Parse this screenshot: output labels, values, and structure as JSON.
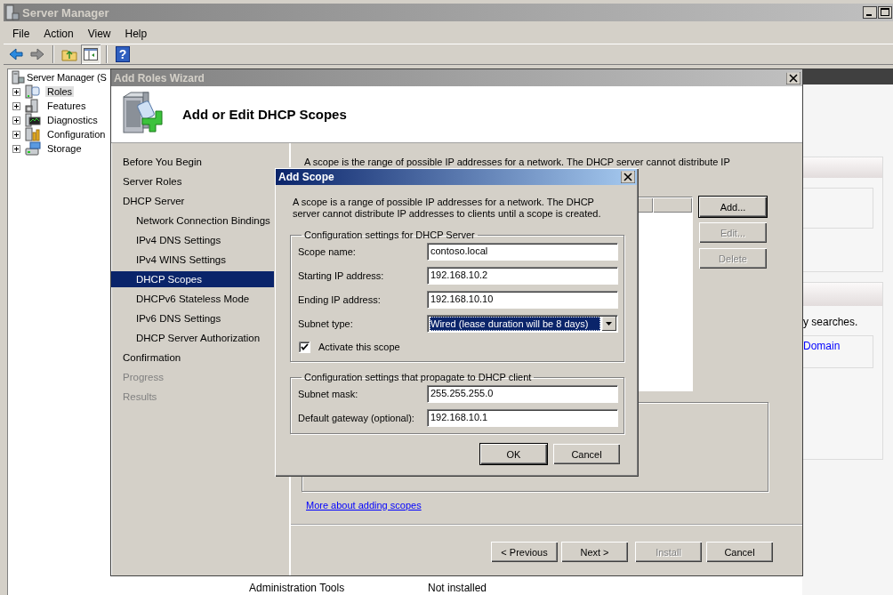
{
  "server_manager": {
    "title": "Server Manager",
    "menu": [
      "File",
      "Action",
      "View",
      "Help"
    ],
    "toolbar": [
      {
        "kind": "back",
        "disabled": false
      },
      {
        "kind": "forward",
        "disabled": true
      },
      {
        "kind": "separator"
      },
      {
        "kind": "folder"
      },
      {
        "kind": "console",
        "pressed": true
      },
      {
        "kind": "separator"
      },
      {
        "kind": "help",
        "label": "?"
      }
    ],
    "tree": [
      {
        "label": "Server Manager (S",
        "selected": false,
        "children": [
          {
            "label": "Roles",
            "selected": true,
            "expanded": false
          },
          {
            "label": "Features",
            "selected": false,
            "expanded": false
          },
          {
            "label": "Diagnostics",
            "selected": false,
            "expanded": false
          },
          {
            "label": "Configuration",
            "selected": false,
            "expanded": false
          },
          {
            "label": "Storage",
            "selected": false,
            "expanded": false
          }
        ]
      }
    ],
    "side_panel": {
      "text": "y searches.",
      "link": "Domain"
    },
    "table_row": {
      "name": "Administration Tools",
      "status": "Not installed"
    }
  },
  "wizard": {
    "title": "Add Roles Wizard",
    "heading": "Add or Edit DHCP Scopes",
    "steps": [
      {
        "label": "Before You Begin",
        "selected": false,
        "disabled": false
      },
      {
        "label": "Server Roles",
        "selected": false,
        "disabled": false
      },
      {
        "label": "DHCP Server",
        "selected": false,
        "disabled": false,
        "children": [
          {
            "label": "Network Connection Bindings",
            "selected": false,
            "disabled": false
          },
          {
            "label": "IPv4 DNS Settings",
            "selected": false,
            "disabled": false
          },
          {
            "label": "IPv4 WINS Settings",
            "selected": false,
            "disabled": false
          },
          {
            "label": "DHCP Scopes",
            "selected": true,
            "disabled": false
          },
          {
            "label": "DHCPv6 Stateless Mode",
            "selected": false,
            "disabled": false
          },
          {
            "label": "IPv6 DNS Settings",
            "selected": false,
            "disabled": false
          },
          {
            "label": "DHCP Server Authorization",
            "selected": false,
            "disabled": false
          }
        ]
      },
      {
        "label": "Confirmation",
        "selected": false,
        "disabled": false
      },
      {
        "label": "Progress",
        "selected": false,
        "disabled": true
      },
      {
        "label": "Results",
        "selected": false,
        "disabled": true
      }
    ],
    "description": "A scope is the range of possible IP addresses for a network. The DHCP server cannot distribute IP",
    "scope_actions": [
      {
        "label": "Add...",
        "disabled": false,
        "default": true
      },
      {
        "label": "Edit...",
        "disabled": true,
        "default": false
      },
      {
        "label": "Delete",
        "disabled": true,
        "default": false
      }
    ],
    "link": "More about adding scopes",
    "buttons": [
      {
        "label": "< Previous",
        "disabled": false
      },
      {
        "label": "Next >",
        "disabled": false
      },
      {
        "label": "Install",
        "disabled": true
      },
      {
        "label": "Cancel",
        "disabled": false
      }
    ]
  },
  "add_scope": {
    "title": "Add Scope",
    "description": "A scope is a range of possible IP addresses for a network. The DHCP server cannot distribute IP addresses to clients until a scope is created.",
    "groups": [
      {
        "legend": "Configuration settings for DHCP Server",
        "fields": [
          {
            "kind": "text",
            "label": "Scope name:",
            "value": "contoso.local"
          },
          {
            "kind": "text",
            "label": "Starting IP address:",
            "value": "192.168.10.2"
          },
          {
            "kind": "text",
            "label": "Ending IP address:",
            "value": "192.168.10.10"
          },
          {
            "kind": "select",
            "label": "Subnet type:",
            "value": "Wired (lease duration will be 8 days)",
            "focused": true
          },
          {
            "kind": "checkbox",
            "label": "Activate this scope",
            "checked": true
          }
        ]
      },
      {
        "legend": "Configuration settings that propagate to DHCP client",
        "fields": [
          {
            "kind": "text",
            "label": "Subnet mask:",
            "value": "255.255.255.0"
          },
          {
            "kind": "text",
            "label": "Default gateway (optional):",
            "value": "192.168.10.1"
          }
        ]
      }
    ],
    "buttons": [
      {
        "label": "OK",
        "default": true
      },
      {
        "label": "Cancel",
        "default": false
      }
    ]
  }
}
